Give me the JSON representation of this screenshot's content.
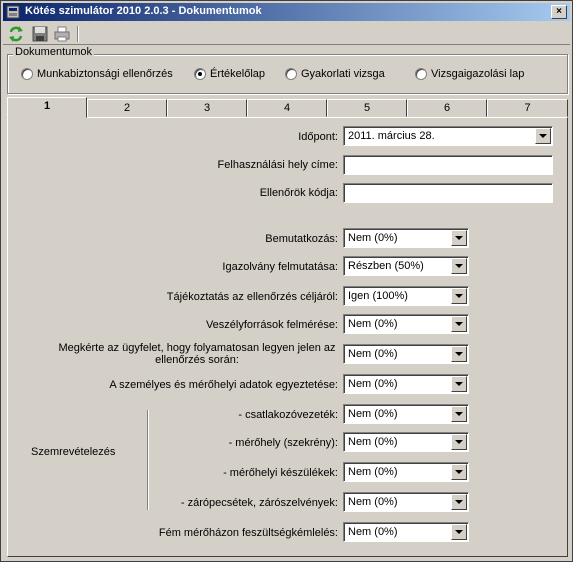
{
  "window": {
    "title": "Kötés szimulátor 2010 2.0.3 - Dokumentumok",
    "close_label": "×"
  },
  "toolbar": {
    "refresh_icon": "refresh-icon",
    "save_icon": "save-icon",
    "print_icon": "print-icon"
  },
  "group": {
    "legend": "Dokumentumok",
    "options": [
      {
        "label": "Munkabiztonsági ellenőrzés",
        "selected": false
      },
      {
        "label": "Értékelőlap",
        "selected": true
      },
      {
        "label": "Gyakorlati vizsga",
        "selected": false
      },
      {
        "label": "Vizsgaigazolási lap",
        "selected": false
      }
    ]
  },
  "tabs": [
    "1",
    "2",
    "3",
    "4",
    "5",
    "6",
    "7"
  ],
  "active_tab": "1",
  "form": {
    "date_label": "Időpont:",
    "date_value": "2011.   március   28.",
    "address_label": "Felhasználási hely címe:",
    "address_value": "",
    "inspector_label": "Ellenőrök kódja:",
    "inspector_value": "",
    "rows": [
      {
        "label": "Bemutatkozás:",
        "value": "Nem (0%)"
      },
      {
        "label": "Igazolvány felmutatása:",
        "value": "Részben (50%)"
      },
      {
        "label": "Tájékoztatás az ellenőrzés céljáról:",
        "value": "Igen (100%)"
      },
      {
        "label": "Veszélyforrások felmérése:",
        "value": "Nem (0%)"
      },
      {
        "label": "Megkérte az ügyfelet, hogy folyamatosan legyen jelen az ellenőrzés során:",
        "value": "Nem (0%)"
      },
      {
        "label": "A személyes és mérőhelyi adatok egyeztetése:",
        "value": "Nem (0%)"
      },
      {
        "label": "- csatlakozóvezeték:",
        "value": "Nem (0%)"
      },
      {
        "label": "- mérőhely (szekrény):",
        "value": "Nem (0%)"
      },
      {
        "label": "- mérőhelyi készülékek:",
        "value": "Nem (0%)"
      },
      {
        "label": "- zárópecsétek, zárószelvények:",
        "value": "Nem (0%)"
      },
      {
        "label": "Fém mérőházon feszültségkémlelés:",
        "value": "Nem (0%)"
      }
    ],
    "group_label": "Szemrevételezés"
  }
}
